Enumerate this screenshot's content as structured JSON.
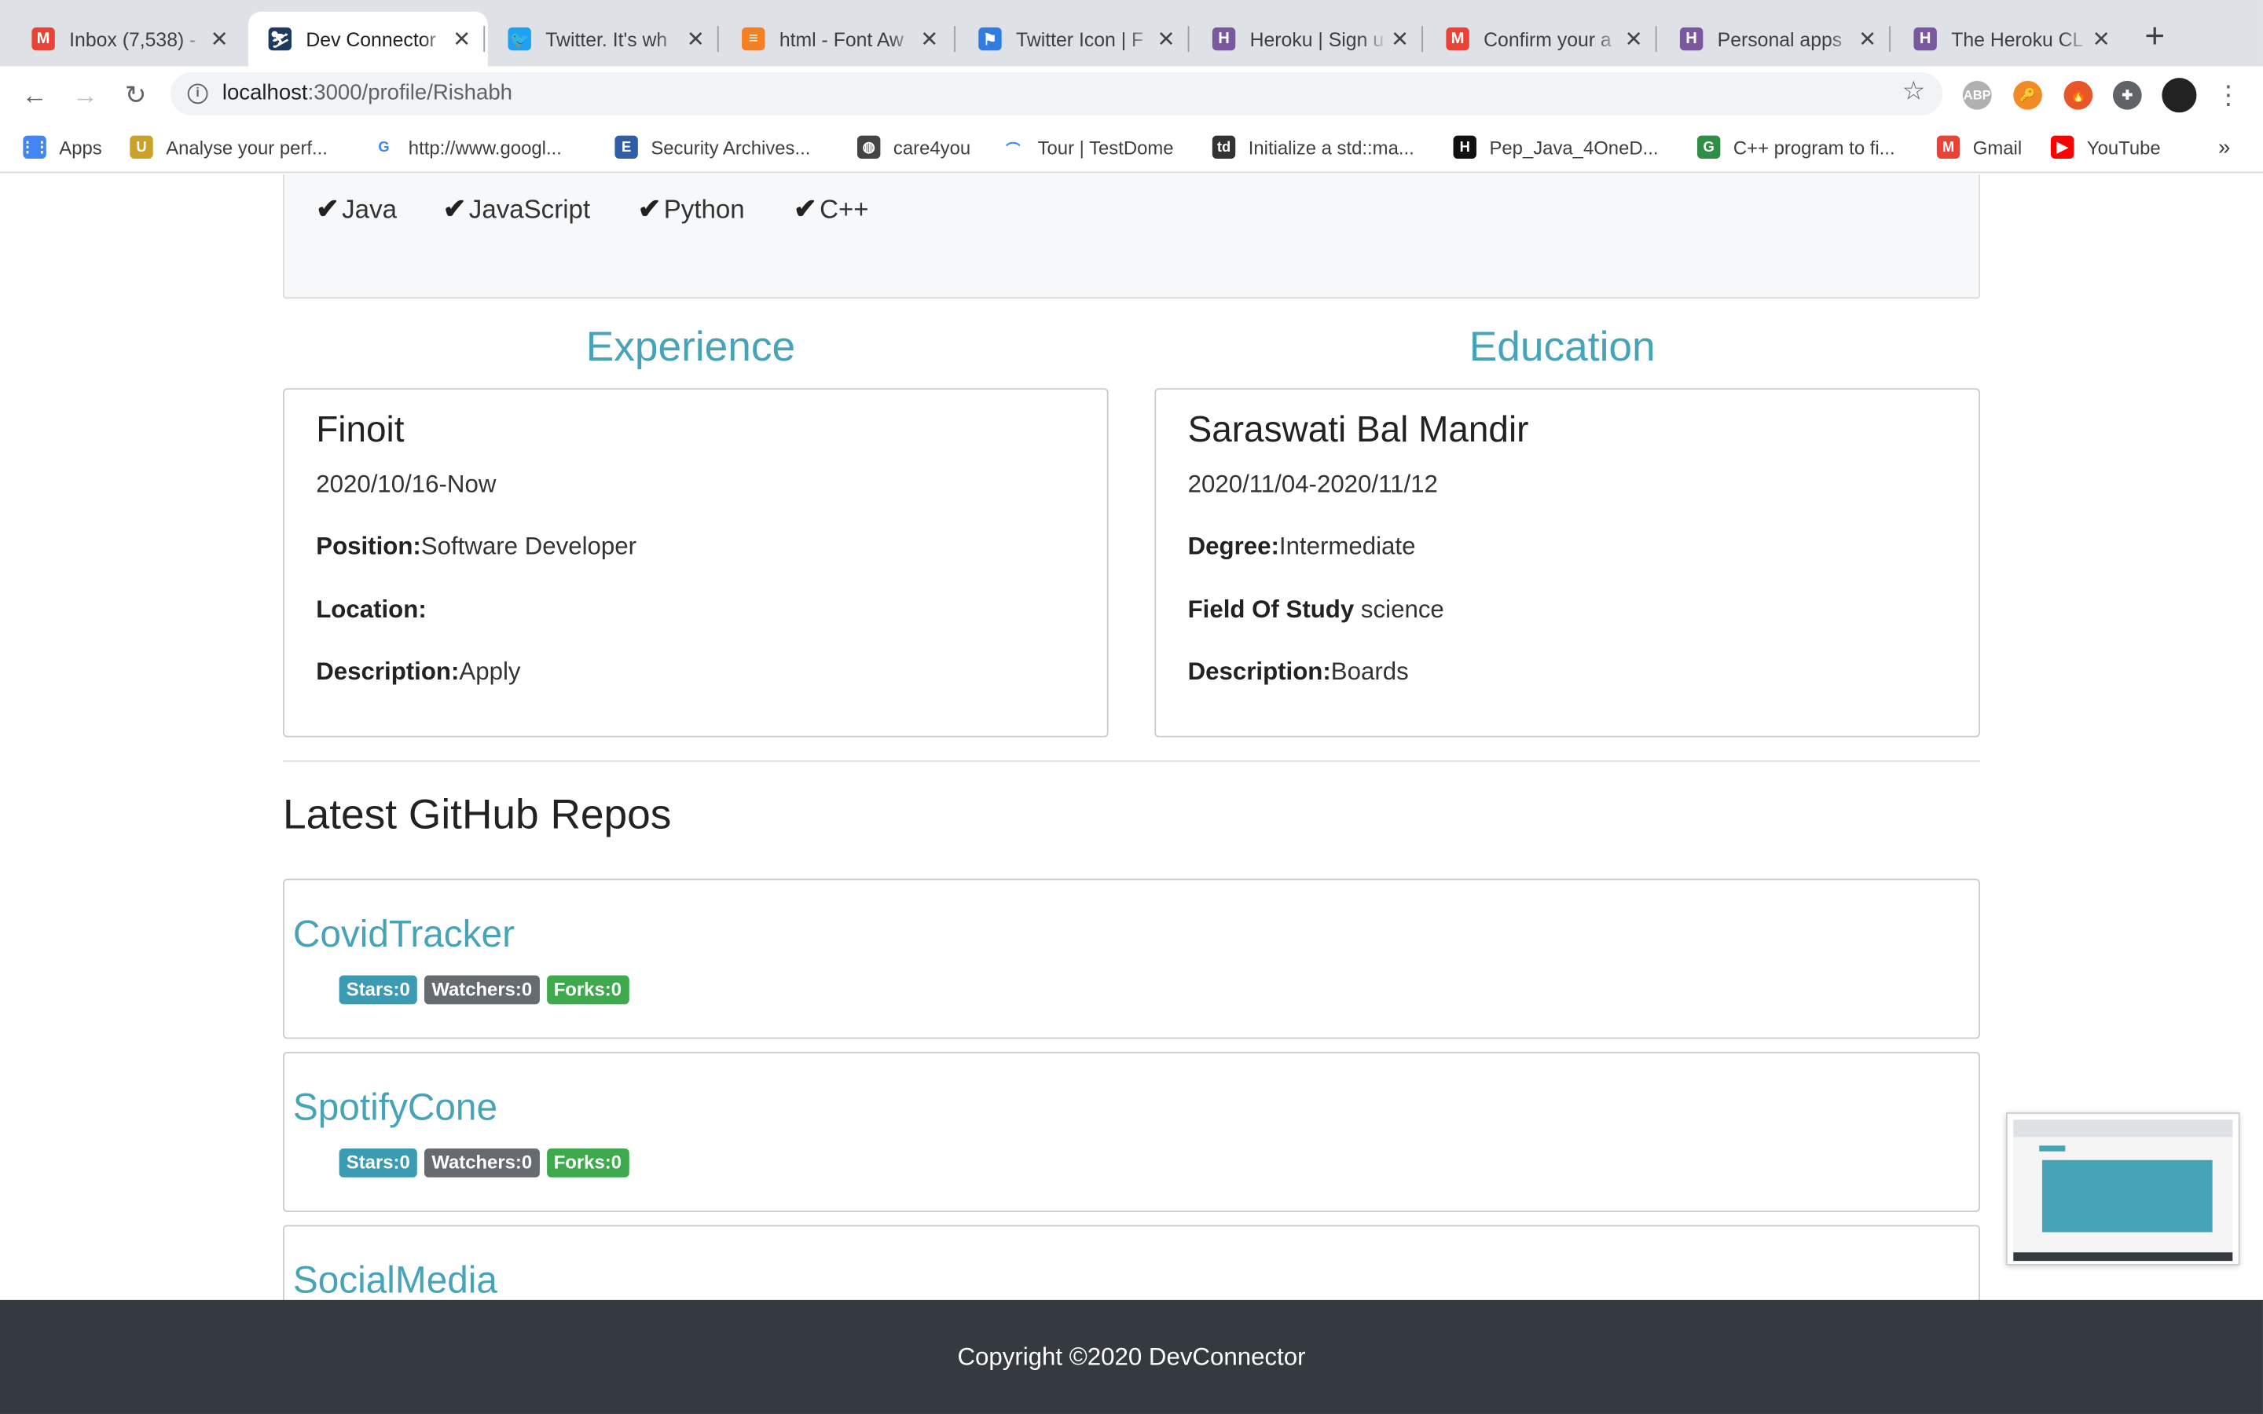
{
  "browser": {
    "tabs": [
      {
        "title": "Inbox (7,538) - ",
        "icon": "gmail-icon",
        "color": "#ea4335",
        "glyph": "M",
        "active": false
      },
      {
        "title": "Dev Connector",
        "icon": "dev-connector-icon",
        "color": "#1e3a5f",
        "glyph": "⛷",
        "active": true
      },
      {
        "title": "Twitter. It's wh",
        "icon": "twitter-icon",
        "color": "#1da1f2",
        "glyph": "🐦",
        "active": false
      },
      {
        "title": "html - Font Aw",
        "icon": "stackoverflow-icon",
        "color": "#f48024",
        "glyph": "≡",
        "active": false
      },
      {
        "title": "Twitter Icon | F",
        "icon": "flag-icon",
        "color": "#2f7de1",
        "glyph": "⚑",
        "active": false
      },
      {
        "title": "Heroku | Sign u",
        "icon": "heroku-icon",
        "color": "#79589f",
        "glyph": "H",
        "active": false
      },
      {
        "title": "Confirm your a",
        "icon": "gmail-icon",
        "color": "#ea4335",
        "glyph": "M",
        "active": false
      },
      {
        "title": "Personal apps",
        "icon": "heroku-icon",
        "color": "#79589f",
        "glyph": "H",
        "active": false
      },
      {
        "title": "The Heroku CL",
        "icon": "heroku-icon",
        "color": "#79589f",
        "glyph": "H",
        "active": false
      }
    ],
    "new_tab": "+",
    "url_host": "localhost",
    "url_path": ":3000/profile/Rishabh",
    "extensions": [
      {
        "icon": "adblock-icon",
        "color": "#b0b0b0",
        "glyph": "ABP"
      },
      {
        "icon": "key-icon",
        "color": "#f28b25",
        "glyph": "🔑"
      },
      {
        "icon": "fire-icon",
        "color": "#e8572a",
        "glyph": "🔥"
      },
      {
        "icon": "puzzle-icon",
        "color": "#5f6368",
        "glyph": "✚"
      },
      {
        "icon": "avatar-icon",
        "color": "#222222",
        "glyph": ""
      }
    ],
    "bookmarks": [
      {
        "label": "Apps",
        "icon": "apps-grid-icon",
        "color": "#4285f4",
        "glyph": "⋮⋮"
      },
      {
        "label": "Analyse your perf...",
        "icon": "analyse-icon",
        "color": "#c9a227",
        "glyph": "U"
      },
      {
        "label": "http://www.googl...",
        "icon": "google-icon",
        "color": "#ffffff",
        "glyph": "G"
      },
      {
        "label": "Security Archives...",
        "icon": "security-icon",
        "color": "#2f5ea8",
        "glyph": "E"
      },
      {
        "label": "care4you",
        "icon": "globe-icon",
        "color": "#444444",
        "glyph": "◍"
      },
      {
        "label": "Tour | TestDome",
        "icon": "testdome-icon",
        "color": "#ffffff",
        "glyph": "⌒"
      },
      {
        "label": "Initialize a std::ma...",
        "icon": "td-icon",
        "color": "#333333",
        "glyph": "td"
      },
      {
        "label": "Pep_Java_4OneD...",
        "icon": "hackerrank-icon",
        "color": "#111111",
        "glyph": "H"
      },
      {
        "label": "C++ program to fi...",
        "icon": "gfg-icon",
        "color": "#2f8d46",
        "glyph": "G"
      },
      {
        "label": "Gmail",
        "icon": "gmail-icon",
        "color": "#ea4335",
        "glyph": "M"
      },
      {
        "label": "YouTube",
        "icon": "youtube-icon",
        "color": "#ff0000",
        "glyph": "▶"
      }
    ],
    "more": "»"
  },
  "profile": {
    "skills": [
      "Java",
      "JavaScript",
      "Python",
      "C++"
    ],
    "experience_title": "Experience",
    "education_title": "Education",
    "experience": {
      "company": "Finoit",
      "dates": "2020/10/16-Now",
      "position_label": "Position:",
      "position": "Software Developer",
      "location_label": "Location:",
      "location": "",
      "description_label": "Description:",
      "description": "Apply"
    },
    "education": {
      "school": "Saraswati Bal Mandir",
      "dates": "2020/11/04-2020/11/12",
      "degree_label": "Degree:",
      "degree": "Intermediate",
      "field_label": "Field Of Study",
      "field": " science",
      "description_label": "Description:",
      "description": "Boards"
    },
    "repos_title": "Latest GitHub Repos",
    "repos": [
      {
        "name": "CovidTracker",
        "stars": "Stars:0",
        "watchers": "Watchers:0",
        "forks": "Forks:0"
      },
      {
        "name": "SpotifyCone",
        "stars": "Stars:0",
        "watchers": "Watchers:0",
        "forks": "Forks:0"
      },
      {
        "name": "SocialMedia",
        "stars": "",
        "watchers": "",
        "forks": ""
      }
    ]
  },
  "footer": {
    "text": "Copyright ©2020 DevConnector"
  },
  "colors": {
    "accent": "#46a3b8",
    "footer_bg": "#343a40",
    "forks_badge": "#3fa94d",
    "watchers_badge": "#666b70"
  }
}
